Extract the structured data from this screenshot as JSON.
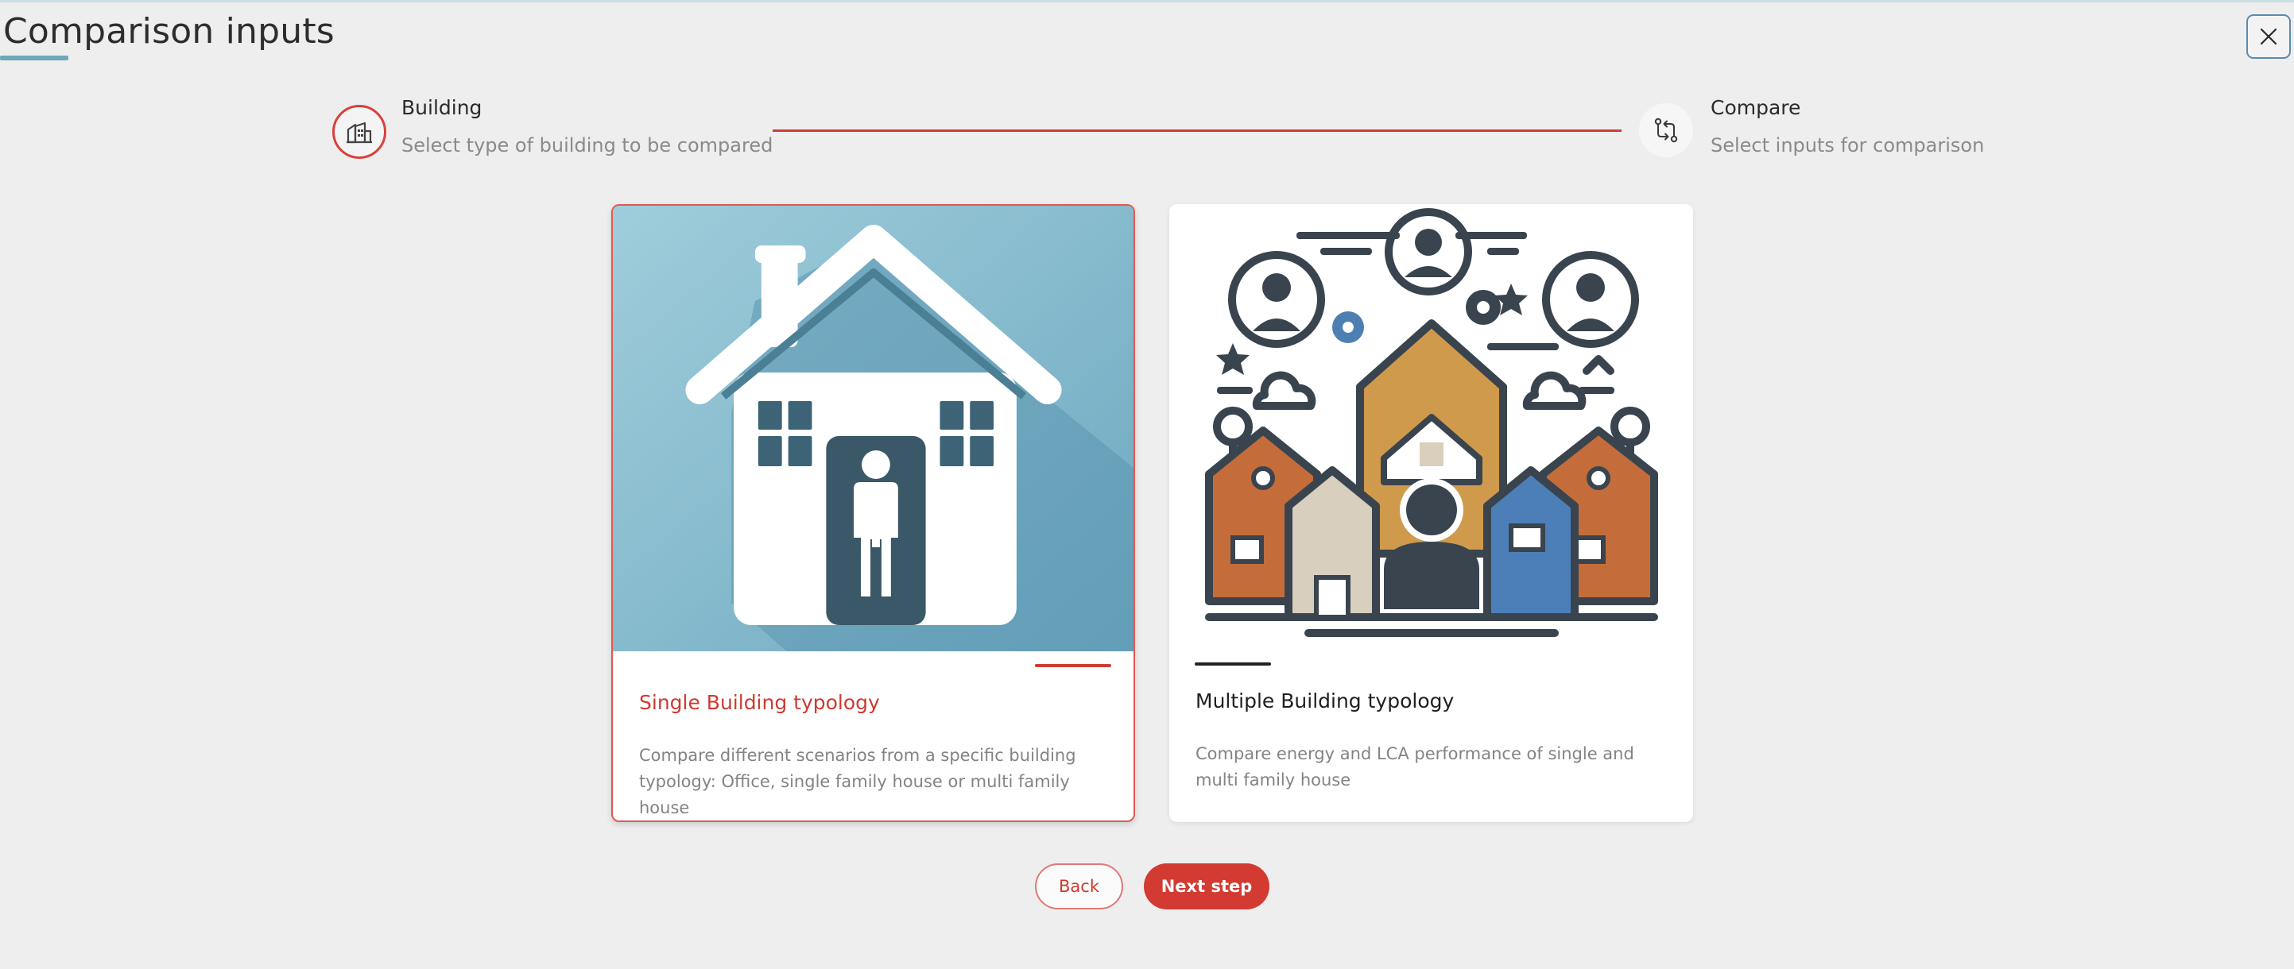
{
  "header": {
    "title": "Comparison inputs",
    "close_icon": "close-icon"
  },
  "stepper": {
    "steps": [
      {
        "label": "Building",
        "description": "Select type of building to be compared",
        "icon": "building-icon",
        "state": "active"
      },
      {
        "label": "Compare",
        "description": "Select inputs for comparison",
        "icon": "compare-arrows-icon",
        "state": "inactive"
      }
    ]
  },
  "cards": [
    {
      "title": "Single Building typology",
      "description": "Compare different scenarios from a specific building typology: Office, single family house or multi family house",
      "selected": true,
      "image": "single-house-illustration"
    },
    {
      "title": "Multiple Building typology",
      "description": "Compare energy and LCA performance of single and multi family house",
      "selected": false,
      "image": "multiple-buildings-illustration"
    }
  ],
  "actions": {
    "back_label": "Back",
    "next_label": "Next step"
  },
  "colors": {
    "accent": "#d23a32",
    "teal": "#6fa8b8",
    "text": "#2d2d2d",
    "muted": "#838383",
    "background": "#eeeeee"
  }
}
